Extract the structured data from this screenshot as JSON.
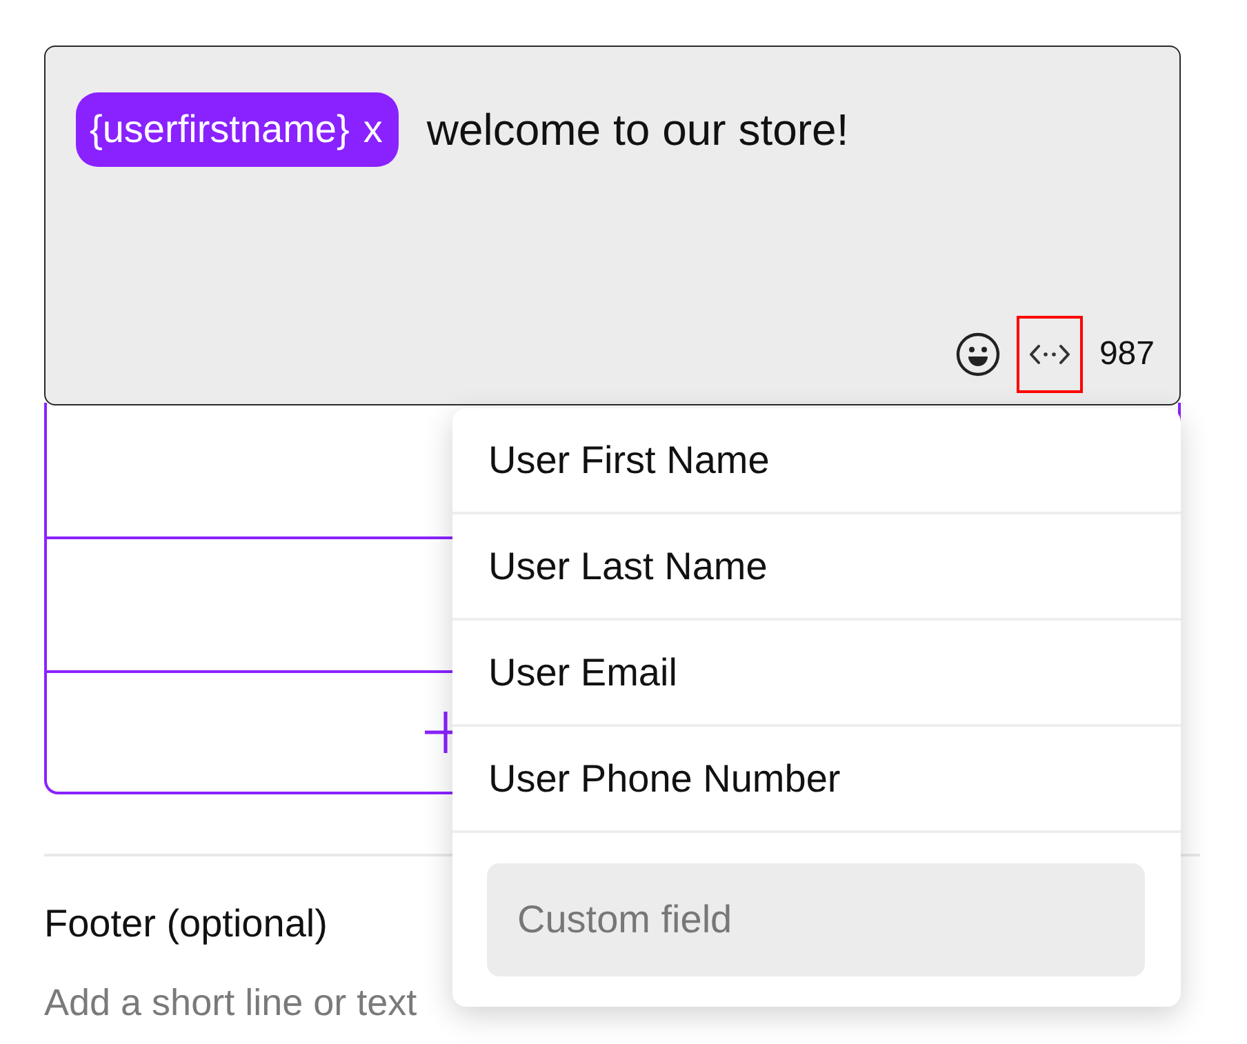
{
  "editor": {
    "segments": [
      {
        "kind": "variable",
        "text": "{userfirstname}",
        "remove": "x"
      },
      {
        "kind": "text",
        "text": "welcome to our store!"
      }
    ],
    "toolbar": {
      "variables_button": {
        "highlighted": true
      },
      "char_count": "987"
    }
  },
  "buttons_panel": {
    "rows": [
      {
        "kind": "blank"
      },
      {
        "kind": "blank"
      },
      {
        "kind": "add"
      }
    ]
  },
  "variables_menu": {
    "items": [
      {
        "label": "User First Name",
        "selected": false
      },
      {
        "label": "User Last Name",
        "selected": false
      },
      {
        "label": "User Email",
        "selected": false
      },
      {
        "label": "User Phone Number",
        "selected": false
      }
    ],
    "custom_field": {
      "placeholder": "Custom field"
    }
  },
  "footer": {
    "label": "Footer (optional)",
    "hint": "Add a short line or text"
  }
}
